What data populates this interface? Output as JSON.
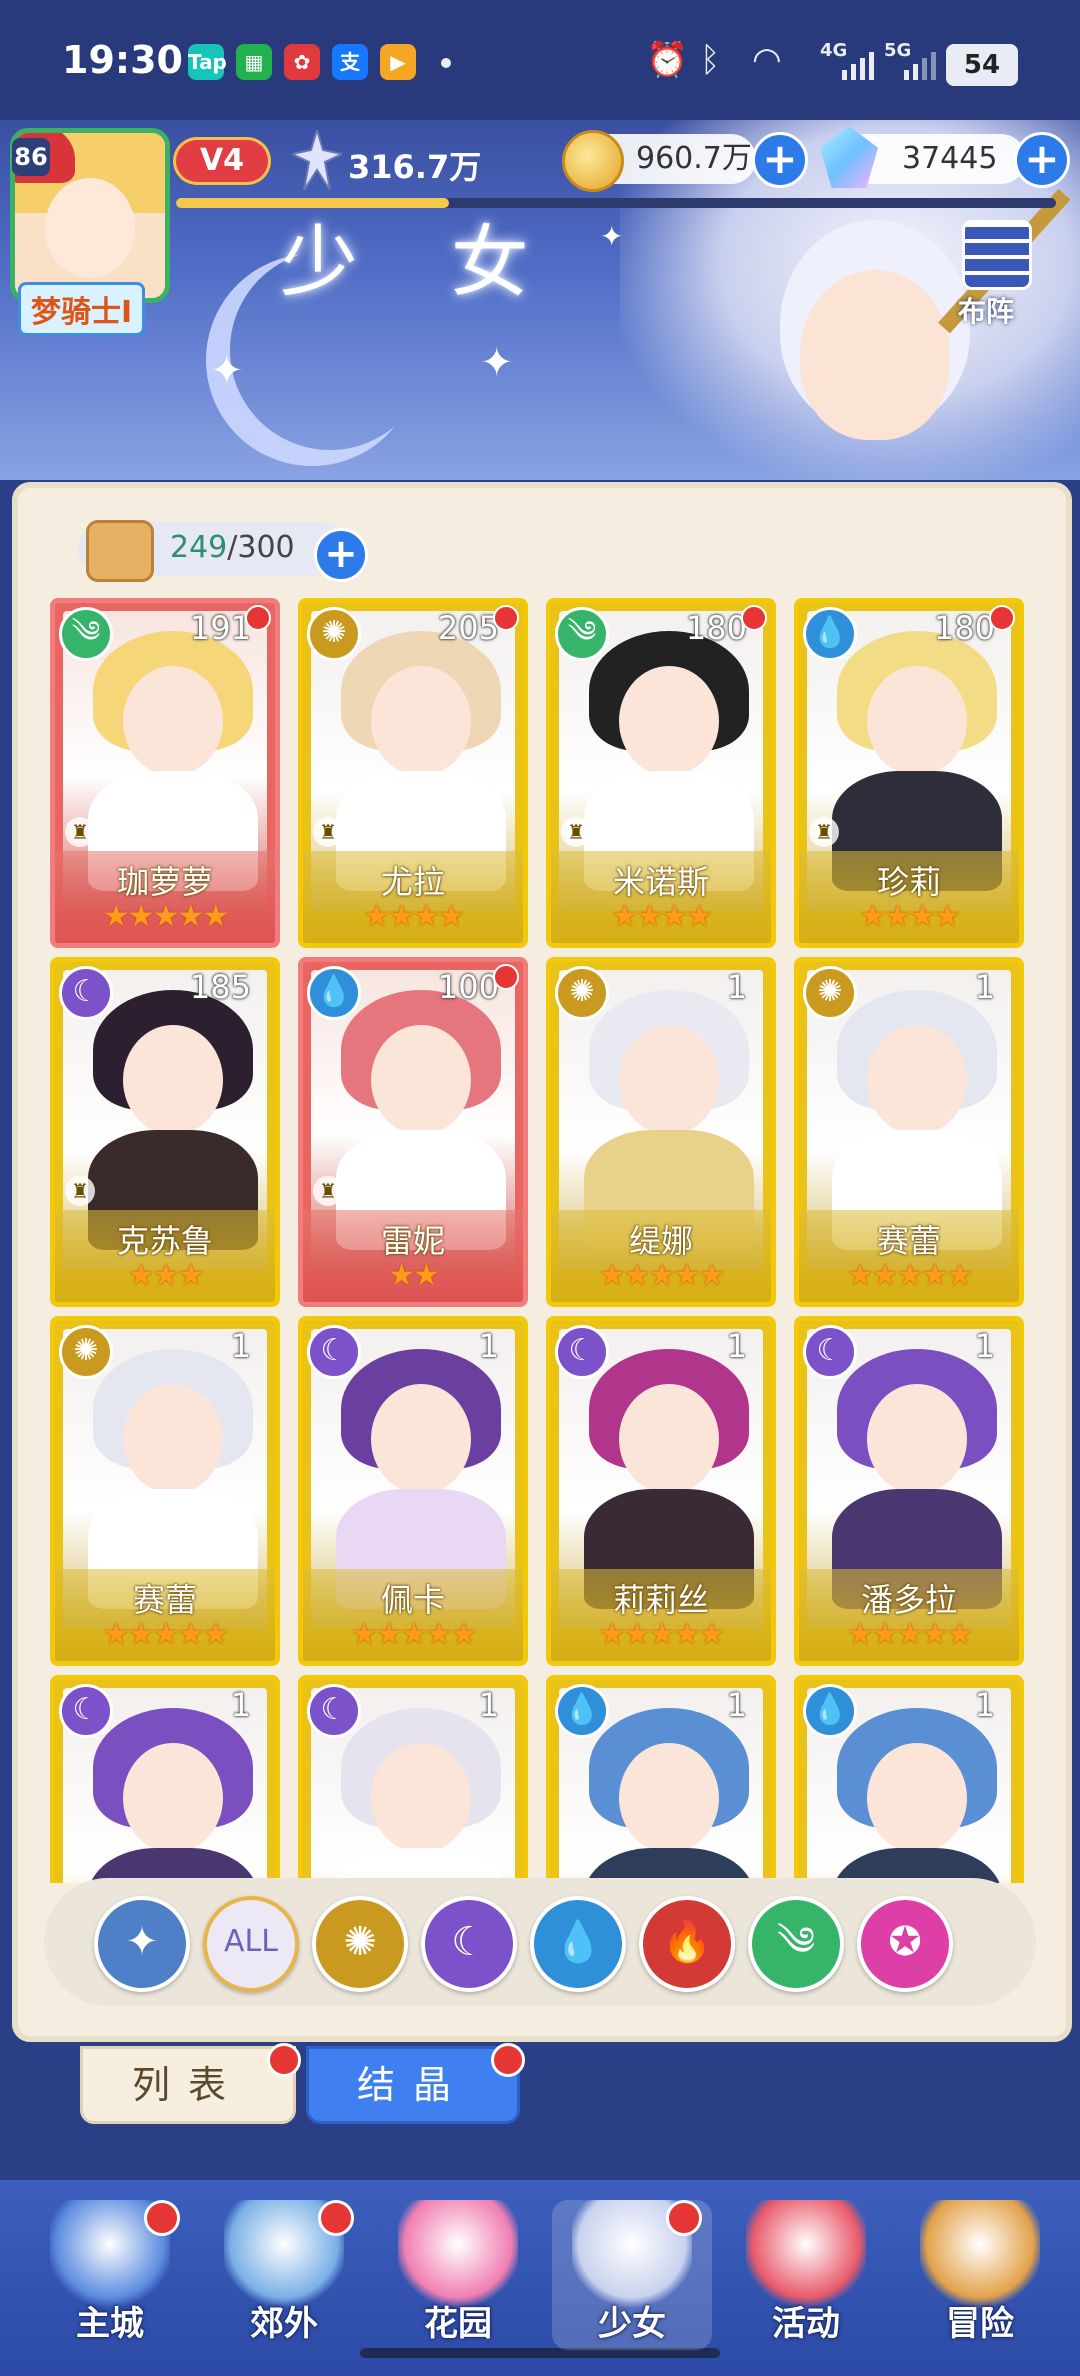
{
  "status_bar": {
    "time": "19:30",
    "apps": [
      {
        "name": "taptap-icon",
        "label": "Tap",
        "color": "#17c4b8"
      },
      {
        "name": "app-grid-icon",
        "label": "▦",
        "color": "#23b14d"
      },
      {
        "name": "pinduoduo-icon",
        "label": "✿",
        "color": "#e0393e"
      },
      {
        "name": "alipay-icon",
        "label": "支",
        "color": "#1677ff"
      },
      {
        "name": "video-app-icon",
        "label": "▶",
        "color": "#f5a623"
      }
    ],
    "battery": "54",
    "network_4g": "4G",
    "network_5g": "5G"
  },
  "player": {
    "level": "86",
    "name": "梦骑士I",
    "vip": "V4",
    "power": "316.7万",
    "xp_fraction": 0.31
  },
  "resources": {
    "gold": "960.7万",
    "gems": "37445"
  },
  "header": {
    "title": "少 女",
    "formation_label": "布阵"
  },
  "roster": {
    "current": "249",
    "max": "/300"
  },
  "colors": {
    "gold_card": "#e9c318",
    "red_card": "#e86561",
    "element_wind": "#36b46a",
    "element_light": "#c99a1f",
    "element_dark": "#7b52c9",
    "element_water": "#2f8fd8",
    "element_fire": "#d33a36",
    "element_star": "#de3fa6"
  },
  "cards": [
    {
      "name": "珈萝萝",
      "level": "191",
      "element": "wind-element-icon",
      "stars": 5,
      "rarity": "red",
      "dot": true,
      "role": true,
      "hair": "#f5d77a",
      "body": "#ffffff"
    },
    {
      "name": "尤拉",
      "level": "205",
      "element": "light-element-icon",
      "stars": 4,
      "rarity": "gold",
      "dot": true,
      "role": true,
      "hair": "#efd7b5",
      "body": "#ffffff"
    },
    {
      "name": "米诺斯",
      "level": "180",
      "element": "wind-element-icon",
      "stars": 4,
      "rarity": "gold",
      "dot": true,
      "role": true,
      "hair": "#222222",
      "body": "#ffffff"
    },
    {
      "name": "珍莉",
      "level": "180",
      "element": "water-element-icon",
      "stars": 4,
      "rarity": "gold",
      "dot": true,
      "role": true,
      "hair": "#f3dc86",
      "body": "#2e2e3a"
    },
    {
      "name": "克苏鲁",
      "level": "185",
      "element": "dark-element-icon",
      "stars": 3,
      "rarity": "gold",
      "dot": false,
      "role": true,
      "hair": "#2c2030",
      "body": "#3b2a2a"
    },
    {
      "name": "雷妮",
      "level": "100",
      "element": "water-element-icon",
      "stars": 2,
      "rarity": "red",
      "dot": true,
      "role": true,
      "hair": "#e5767e",
      "body": "#ffffff"
    },
    {
      "name": "缇娜",
      "level": "1",
      "element": "light-element-icon",
      "stars": 5,
      "rarity": "gold",
      "dot": false,
      "role": false,
      "hair": "#e9eaf1",
      "body": "#e8d28a"
    },
    {
      "name": "赛蕾",
      "level": "1",
      "element": "light-element-icon",
      "stars": 5,
      "rarity": "gold",
      "dot": false,
      "role": false,
      "hair": "#e5e7f0",
      "body": "#ffffff"
    },
    {
      "name": "赛蕾",
      "level": "1",
      "element": "light-element-icon",
      "stars": 5,
      "rarity": "gold",
      "dot": false,
      "role": false,
      "hair": "#e5e7f0",
      "body": "#ffffff"
    },
    {
      "name": "佩卡",
      "level": "1",
      "element": "dark-element-icon",
      "stars": 5,
      "rarity": "gold",
      "dot": false,
      "role": false,
      "hair": "#6a3fa0",
      "body": "#e8d8f3"
    },
    {
      "name": "莉莉丝",
      "level": "1",
      "element": "dark-element-icon",
      "stars": 5,
      "rarity": "gold",
      "dot": false,
      "role": false,
      "hair": "#b2358c",
      "body": "#3a2a36"
    },
    {
      "name": "潘多拉",
      "level": "1",
      "element": "dark-element-icon",
      "stars": 5,
      "rarity": "gold",
      "dot": false,
      "role": false,
      "hair": "#7a4fc0",
      "body": "#4a3670"
    },
    {
      "name": "",
      "level": "1",
      "element": "dark-element-icon",
      "stars": 0,
      "rarity": "gold",
      "dot": false,
      "role": false,
      "hair": "#7a4fc0",
      "body": "#4a3670"
    },
    {
      "name": "",
      "level": "1",
      "element": "dark-element-icon",
      "stars": 0,
      "rarity": "gold",
      "dot": false,
      "role": false,
      "hair": "#e6e3ef",
      "body": "#ffffff"
    },
    {
      "name": "",
      "level": "1",
      "element": "water-element-icon",
      "stars": 0,
      "rarity": "gold",
      "dot": false,
      "role": false,
      "hair": "#5a8fd4",
      "body": "#2e3e5a"
    },
    {
      "name": "",
      "level": "1",
      "element": "water-element-icon",
      "stars": 0,
      "rarity": "gold",
      "dot": false,
      "role": false,
      "hair": "#5a8fd4",
      "body": "#2e3e5a"
    }
  ],
  "filters": [
    {
      "name": "filter-class-icon",
      "label": "✦",
      "color": "#4f7fc6"
    },
    {
      "name": "filter-all-button",
      "label": "ALL",
      "color": "#8c86c9"
    },
    {
      "name": "filter-light-icon",
      "label": "✺",
      "color": "#c99a1f"
    },
    {
      "name": "filter-dark-icon",
      "label": "☾",
      "color": "#7b52c9"
    },
    {
      "name": "filter-water-icon",
      "label": "💧",
      "color": "#2f8fd8"
    },
    {
      "name": "filter-fire-icon",
      "label": "🔥",
      "color": "#d33a36"
    },
    {
      "name": "filter-wind-icon",
      "label": "༄",
      "color": "#36b46a"
    },
    {
      "name": "filter-star-icon",
      "label": "✪",
      "color": "#de3fa6"
    }
  ],
  "tabs": {
    "list": "列表",
    "crystal": "结晶"
  },
  "nav": [
    {
      "name": "nav-main-city",
      "label": "主城",
      "dot": true,
      "color": "#5d8de0"
    },
    {
      "name": "nav-suburbs",
      "label": "郊外",
      "dot": true,
      "color": "#7ab0e6"
    },
    {
      "name": "nav-garden",
      "label": "花园",
      "dot": false,
      "color": "#f07fb2"
    },
    {
      "name": "nav-girls",
      "label": "少女",
      "dot": true,
      "color": "#c9d2ee"
    },
    {
      "name": "nav-events",
      "label": "活动",
      "dot": false,
      "color": "#e85a6a"
    },
    {
      "name": "nav-adventure",
      "label": "冒险",
      "dot": false,
      "color": "#e3a24a"
    }
  ]
}
